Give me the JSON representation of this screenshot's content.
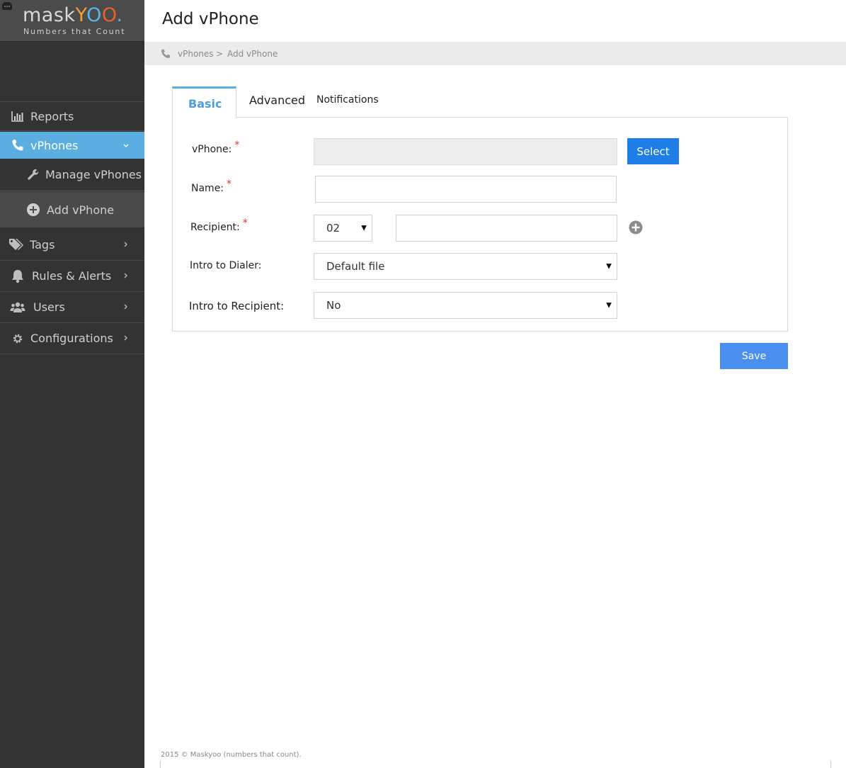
{
  "brand": {
    "logo_mask": "mask",
    "logo_y": "Y",
    "logo_o1": "O",
    "logo_o2": "O",
    "logo_dot": ".",
    "tagline": "Numbers that Count"
  },
  "sidebar": {
    "items": [
      {
        "label": "Reports",
        "icon": "bar-chart-icon"
      },
      {
        "label": "vPhones",
        "icon": "phone-icon"
      },
      {
        "label": "Manage vPhones",
        "icon": "wrench-icon"
      },
      {
        "label": "Add vPhone",
        "icon": "plus-circle-icon"
      },
      {
        "label": "Tags",
        "icon": "tags-icon"
      },
      {
        "label": "Rules & Alerts",
        "icon": "bell-icon"
      },
      {
        "label": "Users",
        "icon": "users-icon"
      },
      {
        "label": "Configurations",
        "icon": "gear-icon"
      }
    ]
  },
  "header": {
    "title": "Add vPhone",
    "breadcrumb": [
      "vPhones",
      ">",
      "Add vPhone"
    ]
  },
  "tabs": [
    "Basic",
    "Advanced",
    "Notifications"
  ],
  "form": {
    "vphone_label": "vPhone:",
    "vphone_value": "",
    "select_label": "Select",
    "name_label": "Name:",
    "name_value": "",
    "recipient_label": "Recipient:",
    "recipient_prefix": "02",
    "recipient_number": "",
    "intro_dialer_label": "Intro to Dialer:",
    "intro_dialer_value": "Default file",
    "intro_recipient_label": "Intro to Recipient:",
    "intro_recipient_value": "No",
    "required_mark": "*",
    "save_label": "Save"
  },
  "footer": {
    "text": "2015 © Maskyoo (numbers that count)."
  },
  "colors": {
    "sidebar_bg": "#333333",
    "active_item": "#5aaee0",
    "select_button": "#1e7de6",
    "save_button": "#4a8ff0",
    "required": "#e03030"
  }
}
